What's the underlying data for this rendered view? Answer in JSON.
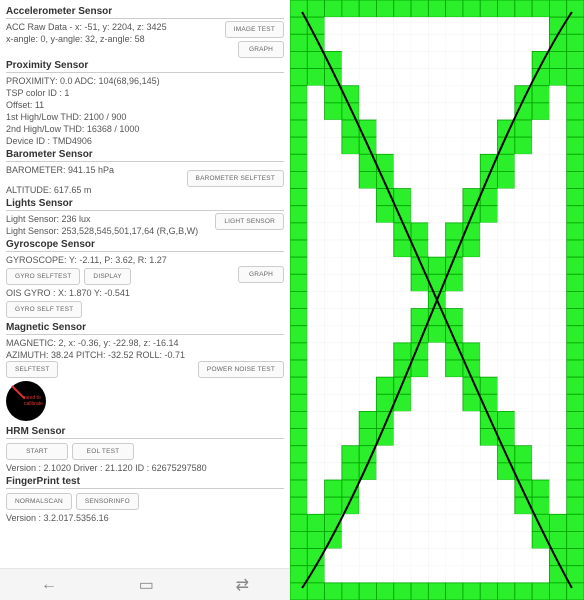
{
  "accelerometer": {
    "title": "Accelerometer Sensor",
    "raw": "ACC Raw Data - x: -51, y: 2204, z: 3425",
    "angle": "x-angle: 0, y-angle: 32, z-angle: 58",
    "image_test": "IMAGE TEST",
    "graph": "GRAPH"
  },
  "proximity": {
    "title": "Proximity Sensor",
    "value": "PROXIMITY: 0.0      ADC: 104(68,96,145)",
    "tsp": "TSP color ID : 1",
    "offset": "Offset: 11",
    "thd1": "1st High/Low THD: 2100 / 900",
    "thd2": "2nd High/Low THD: 16368 / 1000",
    "device": "Device ID : TMD4906"
  },
  "barometer": {
    "title": "Barometer Sensor",
    "value": "BAROMETER: 941.15 hPa",
    "altitude": "ALTITUDE: 617.65 m",
    "selftest": "BAROMETER SELFTEST"
  },
  "lights": {
    "title": "Lights Sensor",
    "lux": "Light Sensor: 236 lux",
    "rgbw": "Light Sensor: 253,528,545,501,17,64 (R,G,B,W)",
    "button": "LIGHT SENSOR"
  },
  "gyroscope": {
    "title": "Gyroscope Sensor",
    "value": "GYROSCOPE: Y: -2.11, P: 3.62, R: 1.27",
    "selftest": "GYRO SELFTEST",
    "display": "DISPLAY",
    "graph": "GRAPH",
    "ois": "OIS GYRO : X: 1.870 Y: -0.541",
    "ois_selftest": "GYRO SELF TEST"
  },
  "magnetic": {
    "title": "Magnetic Sensor",
    "value": "MAGNETIC: 2, x: -0.36, y: -22.98, z: -16.14",
    "azimuth": "AZIMUTH: 38.24    PITCH: -32.52    ROLL: -0.71",
    "selftest": "SELFTEST",
    "power": "POWER NOISE TEST",
    "compass_label": "need to calibrate"
  },
  "hrm": {
    "title": "HRM Sensor",
    "start": "START",
    "eol": "EOL TEST",
    "version": "Version : 2.1020    Driver : 21.120    ID : 62675297580"
  },
  "fingerprint": {
    "title": "FingerPrint test",
    "normal": "NORMALSCAN",
    "sensor": "SENSORINFO",
    "version": "Version : 3.2.017.5356.16"
  },
  "chart_data": {
    "type": "other",
    "description": "Touchscreen test grid with drawn X pattern",
    "grid_cols": 17,
    "grid_rows": 35,
    "cell_color_touched": "#2aef2a",
    "cell_border": "#00a000",
    "stroke_color": "#000000",
    "pattern": "perimeter fully touched plus two diagonals forming an X; freehand black line traces the X"
  }
}
